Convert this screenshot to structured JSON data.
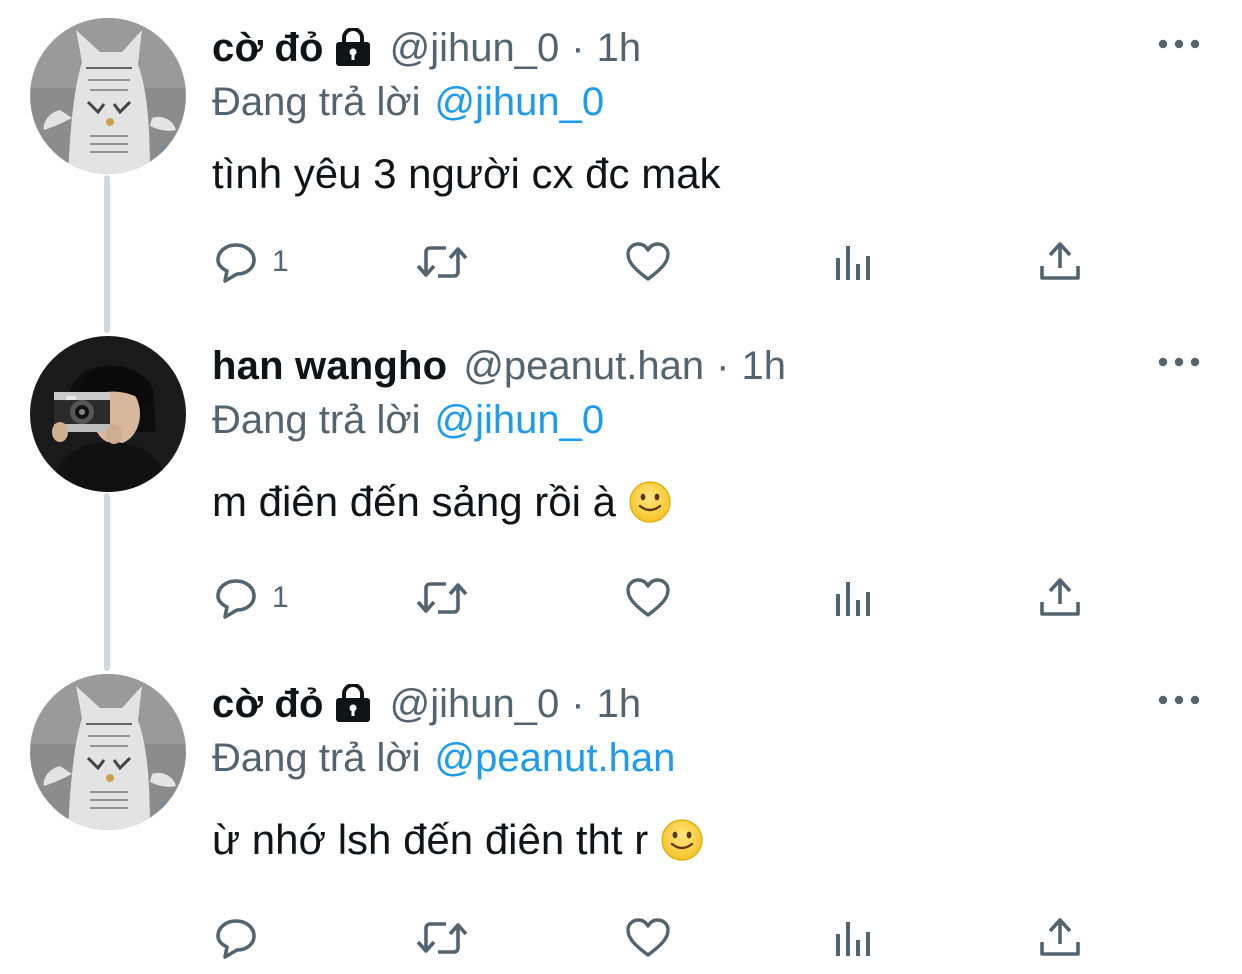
{
  "tweets": [
    {
      "display_name": "cờ đỏ",
      "protected": true,
      "handle": "@jihun_0",
      "separator": "·",
      "time": "1h",
      "reply_label": "Đang trả lời",
      "reply_handle": "@jihun_0",
      "text": "tình yêu 3 người cx đc mak",
      "emoji": "",
      "reply_count": "1",
      "avatar": "white-cat-avatar"
    },
    {
      "display_name": "han wangho",
      "protected": false,
      "handle": "@peanut.han",
      "separator": "·",
      "time": "1h",
      "reply_label": "Đang trả lời",
      "reply_handle": "@jihun_0",
      "text": "m điên đến sảng rồi à",
      "emoji": "slightly-smiling-face",
      "reply_count": "1",
      "avatar": "person-with-camera-avatar"
    },
    {
      "display_name": "cờ đỏ",
      "protected": true,
      "handle": "@jihun_0",
      "separator": "·",
      "time": "1h",
      "reply_label": "Đang trả lời",
      "reply_handle": "@peanut.han",
      "text": "ừ nhớ lsh đến điên tht r",
      "emoji": "slightly-smiling-face",
      "reply_count": "",
      "avatar": "white-cat-avatar"
    }
  ],
  "icons": {
    "reply": "speech-bubble-icon",
    "retweet": "retweet-arrows-icon",
    "like": "heart-icon",
    "views": "bar-chart-icon",
    "share": "share-upload-icon",
    "more": "more-dots-icon",
    "lock": "lock-icon"
  },
  "colors": {
    "text": "#0f1419",
    "secondary": "#536471",
    "link": "#1d9bf0",
    "thread_line": "#cfd9de"
  }
}
